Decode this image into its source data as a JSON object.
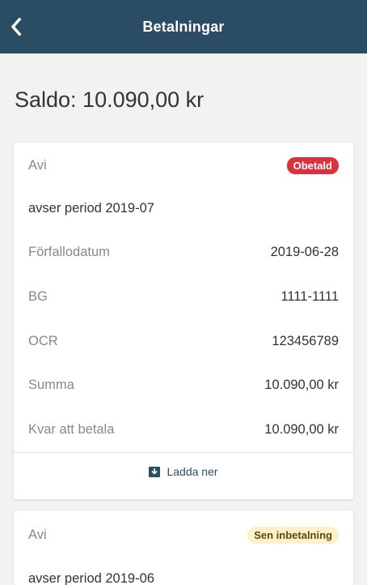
{
  "header": {
    "title": "Betalningar",
    "back_icon": "chevron-left-icon",
    "background": "#2a4d64"
  },
  "balance": {
    "text": "Saldo: 10.090,00 kr"
  },
  "invoices": [
    {
      "type": "Avi",
      "status": "Obetald",
      "status_color": "#d9333f",
      "period": "avser period 2019-07",
      "details": [
        {
          "label": "Förfallodatum",
          "value": "2019-06-28"
        },
        {
          "label": "BG",
          "value": "1111-1111"
        },
        {
          "label": "OCR",
          "value": "123456789"
        },
        {
          "label": "Summa",
          "value": "10.090,00 kr"
        },
        {
          "label": "Kvar att betala",
          "value": "10.090,00 kr"
        }
      ],
      "download_label": "Ladda ner",
      "download_icon": "download-icon"
    },
    {
      "type": "Avi",
      "status": "Sen inbetalning",
      "status_color": "#fdf1c9",
      "period": "avser period 2019-06"
    }
  ]
}
